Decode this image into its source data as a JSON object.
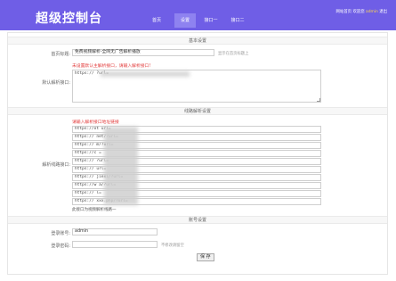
{
  "header": {
    "logo": "超级控制台",
    "nav": [
      {
        "label": "首页"
      },
      {
        "label": "设置"
      },
      {
        "label": "接口一"
      },
      {
        "label": "接口二"
      }
    ],
    "right": {
      "site_home": "网站首页",
      "welcome": "欢迎您",
      "user": "admin",
      "logout": "退出"
    }
  },
  "basic": {
    "section_title": "基本设置",
    "page_title_label": "首页标题:",
    "page_title_value": "免费视频解析-全网无广告解析播放",
    "page_title_hint": "显示在首页标题上",
    "default_api_label": "默认解析接口:",
    "default_api_warning": "未设置默认主解析接口，请输入解析接口!",
    "default_api_value": "https://              ?url="
  },
  "list": {
    "section_title": "线路解析设置",
    "api_label": "解析线路接口:",
    "warning": "请输入解析接口地址链接",
    "lines": [
      "https://ot      url=",
      "https://        net/?url=",
      "https://        m/?url=",
      "https://c       =",
      "https://        ?url=",
      "https://        url=",
      "https://        jiexi/?url=",
      "https://w       a/?url=",
      "https://        l=",
      "https://        xxx.php/?url="
    ],
    "note": "此接口为视频解析线路一"
  },
  "account": {
    "section_title": "账号设置",
    "username_label": "登录账号:",
    "username_value": "admin",
    "password_label": "登录密码:",
    "password_value": "",
    "password_hint": "不修改请留空"
  },
  "footer": {
    "save_label": "保 存"
  }
}
